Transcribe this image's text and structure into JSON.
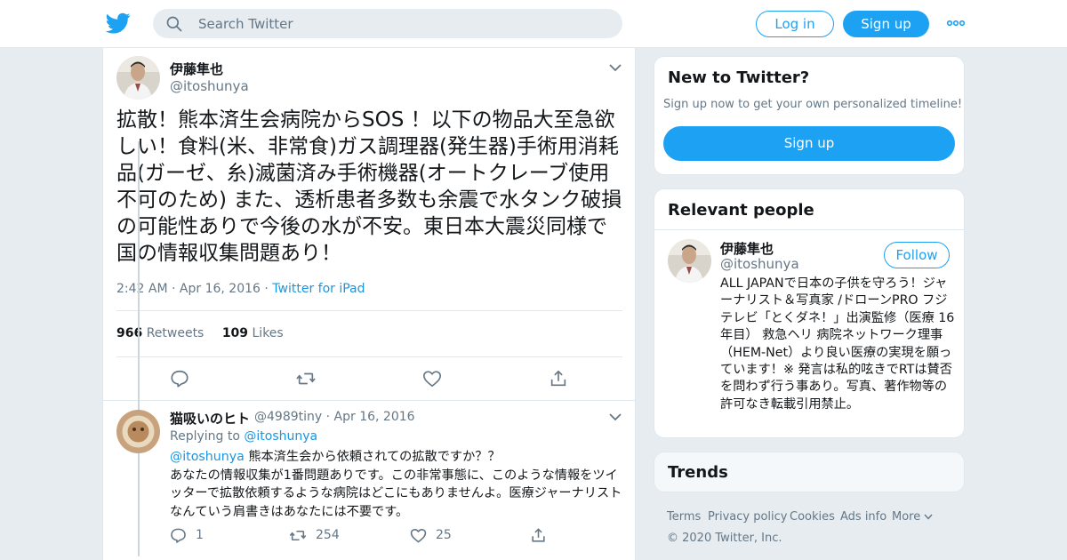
{
  "topbar": {
    "search_placeholder": "Search Twitter",
    "login_label": "Log in",
    "signup_label": "Sign up",
    "brand_color": "#1da1f2"
  },
  "tweet": {
    "name": "伊藤隼也",
    "handle": "@itoshunya",
    "text": "拡散！熊本済生会病院からSOS ！以下の物品大至急欲しい！食料(米、非常食)ガス調理器(発生器)手術用消耗品(ガーゼ、糸)滅菌済み手術機器(オートクレーブ使用不可のため) また、透析患者多数も余震で水タンク破損の可能性ありで今後の水が不安。東日本大震災同様で国の情報収集問題あり！",
    "time": "2:42 AM",
    "date": "Apr 16, 2016",
    "source": "Twitter for iPad",
    "retweets_count": "966",
    "retweets_label": "Retweets",
    "likes_count": "109",
    "likes_label": "Likes"
  },
  "reply": {
    "name": "猫吸いのヒト",
    "handle": "@4989tiny",
    "date": "Apr 16, 2016",
    "replying_to_label": "Replying to",
    "replying_to_handle": "@itoshunya",
    "mention": "@itoshunya",
    "text_line1": " 熊本済生会から依頼されての拡散ですか？？",
    "text_rest": "あなたの情報収集が1番問題ありです。この非常事態に、このような情報をツイッターで拡散依頼するような病院はどこにもありませんよ。医療ジャーナリストなんていう肩書きはあなたには不要です。",
    "reply_count": "1",
    "retweet_count": "254",
    "like_count": "25"
  },
  "sidebar": {
    "new_title": "New to Twitter?",
    "new_sub": "Sign up now to get your own personalized timeline!",
    "new_signup": "Sign up",
    "relevant_title": "Relevant people",
    "person_name": "伊藤隼也",
    "person_handle": "@itoshunya",
    "follow_label": "Follow",
    "person_bio": "ALL JAPANで日本の子供を守ろう！ジャーナリスト＆写真家 /ドローンPRO フジテレビ「とくダネ！」出演監修（医療 16年目） 救急ヘリ 病院ネットワーク理事（HEM-Net）より良い医療の実現を願っています！※ 発言は私的呟きでRTは賛否を問わず行う事あり。写真、著作物等の許可なき転載引用禁止。",
    "trends_title": "Trends"
  },
  "footer": {
    "terms": "Terms",
    "privacy": "Privacy policy",
    "cookies": "Cookies",
    "ads": "Ads info",
    "more": "More",
    "copyright": "© 2020 Twitter, Inc."
  }
}
